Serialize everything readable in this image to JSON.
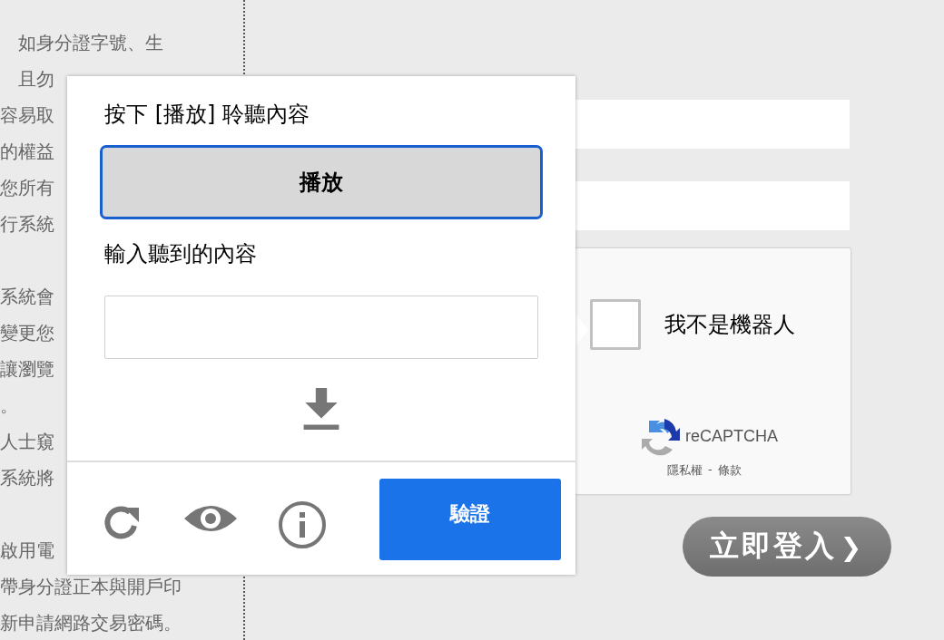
{
  "notice_paragraphs": [
    [
      "如身分證字號、生",
      "且勿",
      "容易取",
      "的權益",
      "您所有",
      "行系統"
    ],
    [
      "系統會",
      "變更您",
      "讓瀏覽",
      "。",
      "人士窺",
      "系統將"
    ],
    [
      "啟用電",
      "帶身分證正本與開戶印",
      "新申請網路交易密碼。"
    ]
  ],
  "login_form": {
    "fields": [
      {
        "kind": "text"
      },
      {
        "kind": "password"
      }
    ],
    "captcha": {
      "label": "我不是機器人",
      "checked": false,
      "brand": "reCAPTCHA",
      "privacy_link": "隱私權",
      "separator": "-",
      "terms_link": "條款"
    },
    "login_button": {
      "label": "立即登入",
      "chevron": "❯"
    }
  },
  "audio_challenge": {
    "instruction": "按下 [播放] 聆聽內容",
    "play_button": "播放",
    "input_label": "輸入聽到的內容",
    "verify_button": "驗證"
  }
}
